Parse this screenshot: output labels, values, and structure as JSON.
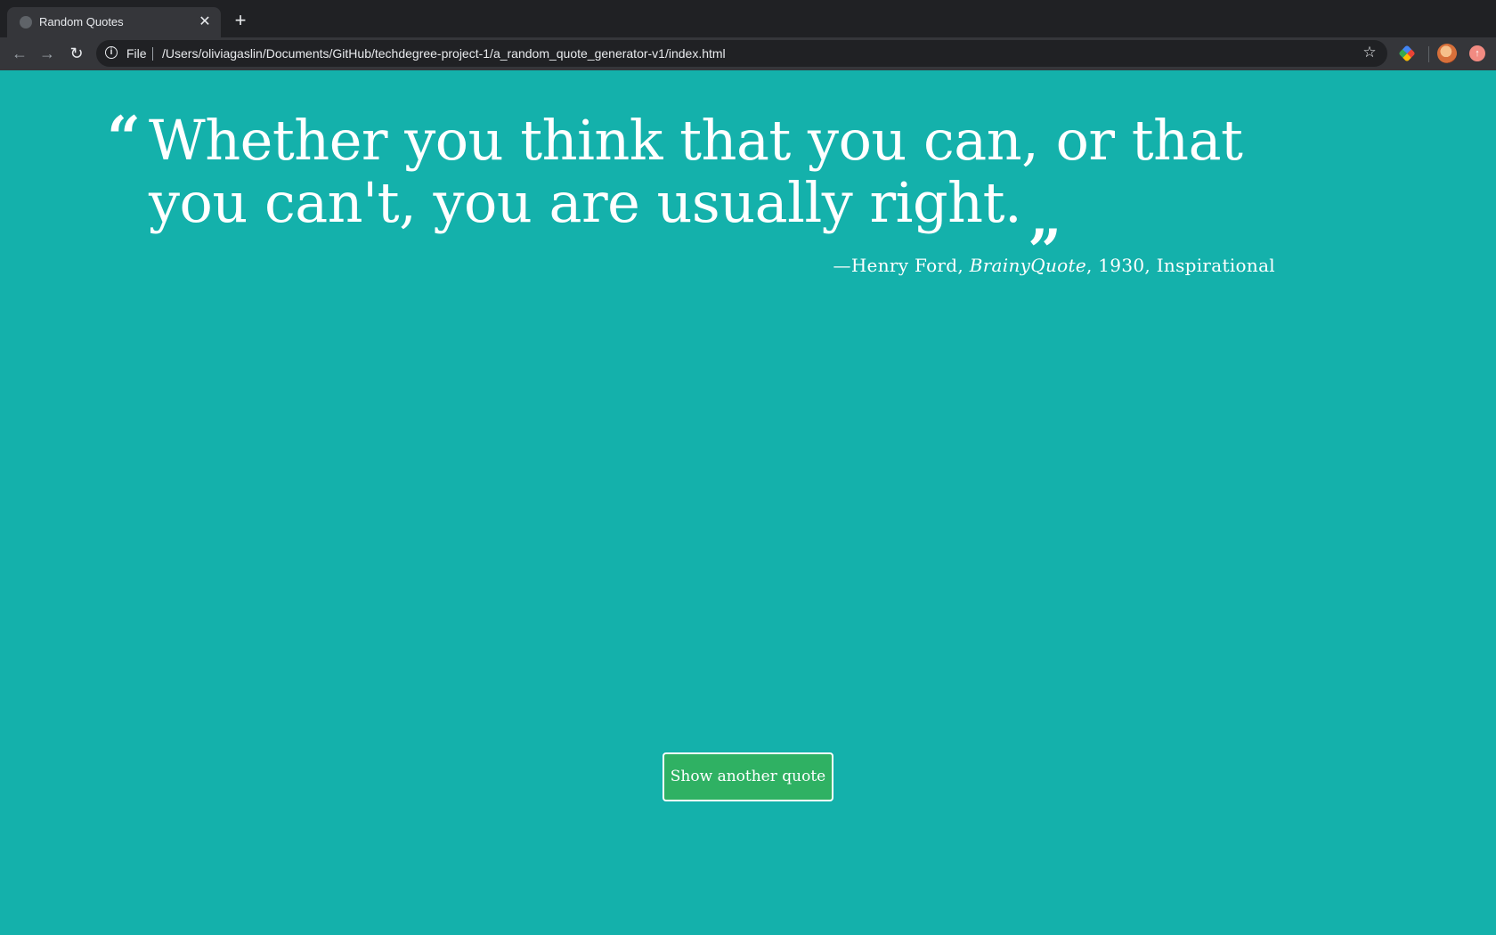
{
  "browser": {
    "tab": {
      "title": "Random Quotes",
      "favicon": "globe-icon",
      "close_glyph": "✕"
    },
    "new_tab_glyph": "+",
    "toolbar": {
      "back_glyph": "←",
      "forward_glyph": "→",
      "reload_glyph": "↻",
      "info_glyph": "i",
      "scheme_label": "File",
      "url": "/Users/oliviagaslin/Documents/GitHub/techdegree-project-1/a_random_quote_generator-v1/index.html",
      "bookmark_glyph": "☆",
      "extension_icon": "color-extension-icon",
      "profile_icon": "avatar-icon",
      "update_glyph": "↑"
    }
  },
  "page": {
    "background_color": "#14b1ab",
    "button_color": "#2fb163",
    "quote": {
      "open_mark": "“",
      "text": "Whether you think that you can, or that you can't, you are usually right.",
      "close_mark": "„",
      "source_prefix": "—Henry Ford, ",
      "citation": "BrainyQuote",
      "year": ", 1930, ",
      "tags": "Inspirational"
    },
    "button_label": "Show another quote"
  }
}
